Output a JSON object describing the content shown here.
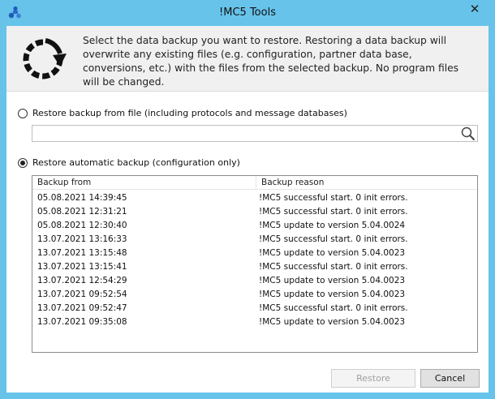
{
  "window": {
    "title": "!MC5 Tools",
    "close_glyph": "✕"
  },
  "header": {
    "icon": "restore-circular-arrow-icon",
    "text": "Select the data backup you want to restore. Restoring a data backup will overwrite any existing files (e.g. configuration, partner data base, conversions, etc.) with the files from the selected backup. No program files will be changed."
  },
  "option_file": {
    "label": "Restore backup from file (including protocols and message databases)",
    "checked": false,
    "input_value": "",
    "input_placeholder": ""
  },
  "option_auto": {
    "label": "Restore automatic backup (configuration only)",
    "checked": true
  },
  "backup_list": {
    "columns": [
      "Backup from",
      "Backup reason"
    ],
    "rows": [
      [
        "05.08.2021 14:39:45",
        "!MC5 successful start. 0 init errors."
      ],
      [
        "05.08.2021 12:31:21",
        "!MC5 successful start. 0 init errors."
      ],
      [
        "05.08.2021 12:30:40",
        "!MC5 update to version 5.04.0024"
      ],
      [
        "13.07.2021 13:16:33",
        "!MC5 successful start. 0 init errors."
      ],
      [
        "13.07.2021 13:15:48",
        "!MC5 update to version 5.04.0023"
      ],
      [
        "13.07.2021 13:15:41",
        "!MC5 successful start. 0 init errors."
      ],
      [
        "13.07.2021 12:54:29",
        "!MC5 update to version 5.04.0023"
      ],
      [
        "13.07.2021 09:52:54",
        "!MC5 update to version 5.04.0023"
      ],
      [
        "13.07.2021 09:52:47",
        "!MC5 successful start. 0 init errors."
      ],
      [
        "13.07.2021 09:35:08",
        "!MC5 update to version 5.04.0023"
      ]
    ]
  },
  "buttons": {
    "restore_label": "Restore",
    "restore_enabled": false,
    "cancel_label": "Cancel"
  },
  "colors": {
    "title_bar": "#67c3ea",
    "header_bg": "#f0f0f0",
    "disabled_text": "#a0a0a0"
  }
}
